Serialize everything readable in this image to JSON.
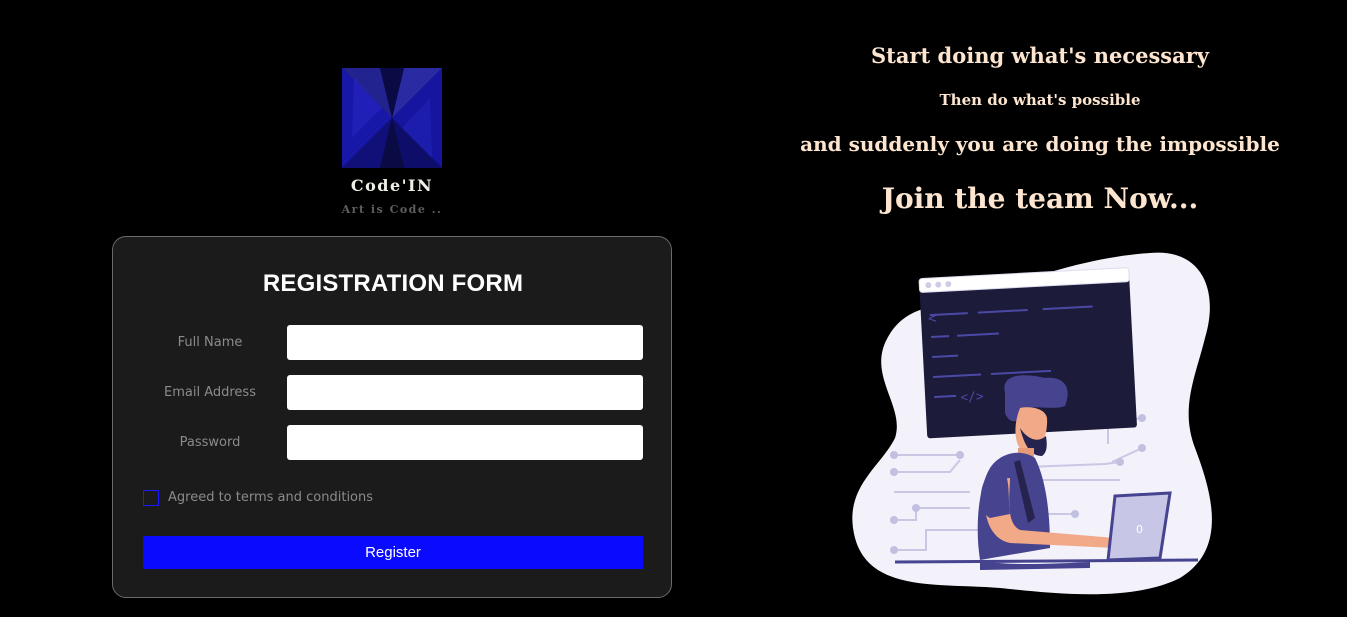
{
  "brand": {
    "name": "Code'IN",
    "tagline": "Art is Code ..",
    "logo_color": "#1a1a8c"
  },
  "form": {
    "title": "REGISTRATION FORM",
    "fields": [
      {
        "label": "Full Name",
        "value": "",
        "type": "text"
      },
      {
        "label": "Email Address",
        "value": "",
        "type": "email"
      },
      {
        "label": "Password",
        "value": "",
        "type": "password"
      }
    ],
    "terms_label": "Agreed to terms and conditions",
    "terms_checked": false,
    "register_label": "Register"
  },
  "quotes": {
    "line1": "Start doing what's necessary",
    "line2": "Then do what's possible",
    "line3": "and suddenly you are doing the impossible",
    "cta": "Join the team Now..."
  },
  "illustration": {
    "icon": "developer-at-laptop-illustration",
    "code_symbol": "</>",
    "accent": "#46448f"
  },
  "colors": {
    "background": "#000000",
    "card": "#1b1b1b",
    "button": "#0a0aff",
    "quote_text": "#fde5cf"
  }
}
